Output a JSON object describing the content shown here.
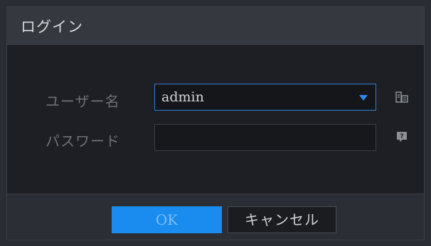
{
  "dialog": {
    "title": "ログイン"
  },
  "form": {
    "username_label": "ユーザー名",
    "username_value": "admin",
    "password_label": "パスワード",
    "password_value": ""
  },
  "icons": {
    "username_side": "keyboard-icon",
    "password_side": "help-icon"
  },
  "buttons": {
    "ok_label": "OK",
    "cancel_label": "キャンセル"
  },
  "colors": {
    "accent": "#1a8cf0",
    "focus_border": "#2e7fd6"
  }
}
